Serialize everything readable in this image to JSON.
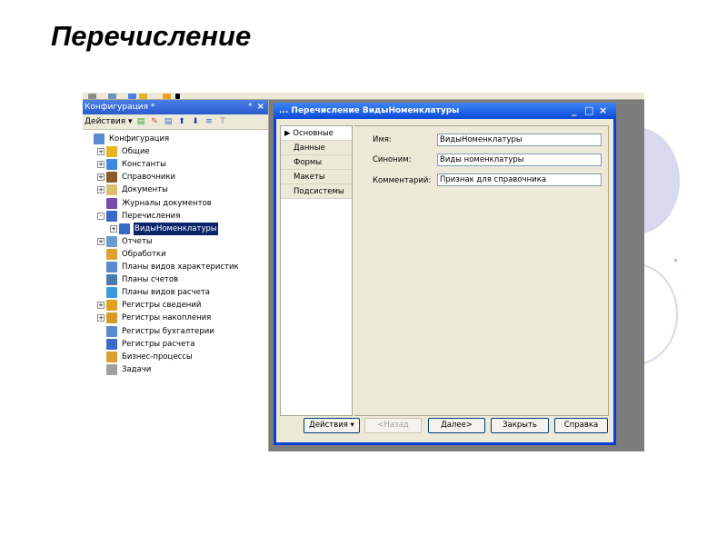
{
  "slide": {
    "title": "Перечисление"
  },
  "config_panel": {
    "title": "Конфигурация",
    "title_suffix": "*",
    "pin_label": "⁴",
    "close_label": "×",
    "toolbar_actions_label": "Действия ▾",
    "tree": [
      {
        "label": "Конфигурация",
        "icon": "config-icon",
        "expand": "",
        "indent": 0
      },
      {
        "label": "Общие",
        "icon": "general-icon",
        "expand": "+",
        "indent": 1
      },
      {
        "label": "Константы",
        "icon": "constants-icon",
        "expand": "+",
        "indent": 1
      },
      {
        "label": "Справочники",
        "icon": "catalogs-icon",
        "expand": "+",
        "indent": 1
      },
      {
        "label": "Документы",
        "icon": "documents-icon",
        "expand": "+",
        "indent": 1
      },
      {
        "label": "Журналы документов",
        "icon": "journals-icon",
        "expand": "",
        "indent": 1
      },
      {
        "label": "Перечисления",
        "icon": "enumerations-icon",
        "expand": "-",
        "indent": 1
      },
      {
        "label": "ВидыНоменклатуры",
        "icon": "enumeration-item-icon",
        "expand": "+",
        "indent": 2,
        "selected": true
      },
      {
        "label": "Отчеты",
        "icon": "reports-icon",
        "expand": "+",
        "indent": 1
      },
      {
        "label": "Обработки",
        "icon": "processing-icon",
        "expand": "",
        "indent": 1
      },
      {
        "label": "Планы видов характеристик",
        "icon": "char-plans-icon",
        "expand": "",
        "indent": 1
      },
      {
        "label": "Планы счетов",
        "icon": "accounts-plans-icon",
        "expand": "",
        "indent": 1
      },
      {
        "label": "Планы видов расчета",
        "icon": "calc-plans-icon",
        "expand": "",
        "indent": 1
      },
      {
        "label": "Регистры сведений",
        "icon": "info-registers-icon",
        "expand": "+",
        "indent": 1
      },
      {
        "label": "Регистры накопления",
        "icon": "accum-registers-icon",
        "expand": "+",
        "indent": 1
      },
      {
        "label": "Регистры бухгалтерии",
        "icon": "accounting-registers-icon",
        "expand": "",
        "indent": 1
      },
      {
        "label": "Регистры расчета",
        "icon": "calc-registers-icon",
        "expand": "",
        "indent": 1
      },
      {
        "label": "Бизнес-процессы",
        "icon": "business-process-icon",
        "expand": "",
        "indent": 1
      },
      {
        "label": "Задачи",
        "icon": "tasks-icon",
        "expand": "",
        "indent": 1
      }
    ]
  },
  "dialog": {
    "title": "Перечисление ВидыНоменклатуры",
    "title_prefix": "...",
    "minimize": "_",
    "maximize": "□",
    "close": "×",
    "tabs": [
      {
        "label": "Основные",
        "active": true,
        "marker": "▶"
      },
      {
        "label": "Данные"
      },
      {
        "label": "Формы"
      },
      {
        "label": "Макеты"
      },
      {
        "label": "Подсистемы"
      }
    ],
    "fields": {
      "name_label": "Имя:",
      "name_value": "ВидыНоменклатуры",
      "synonym_label": "Синоним:",
      "synonym_value": "Виды номенклатуры",
      "comment_label": "Комментарий:",
      "comment_value": "Признак для справочника"
    },
    "buttons": {
      "actions": "Действия ▾",
      "back": "<Назад",
      "next": "Далее>",
      "close": "Закрыть",
      "help": "Справка"
    }
  },
  "colors": {
    "xp_title_blue": "#2a5ccc",
    "selection": "#0a246a",
    "dialog_bg": "#ece9d8",
    "backdrop_gray": "#7c7c7c",
    "deco_circle": "#d8d8ee"
  }
}
